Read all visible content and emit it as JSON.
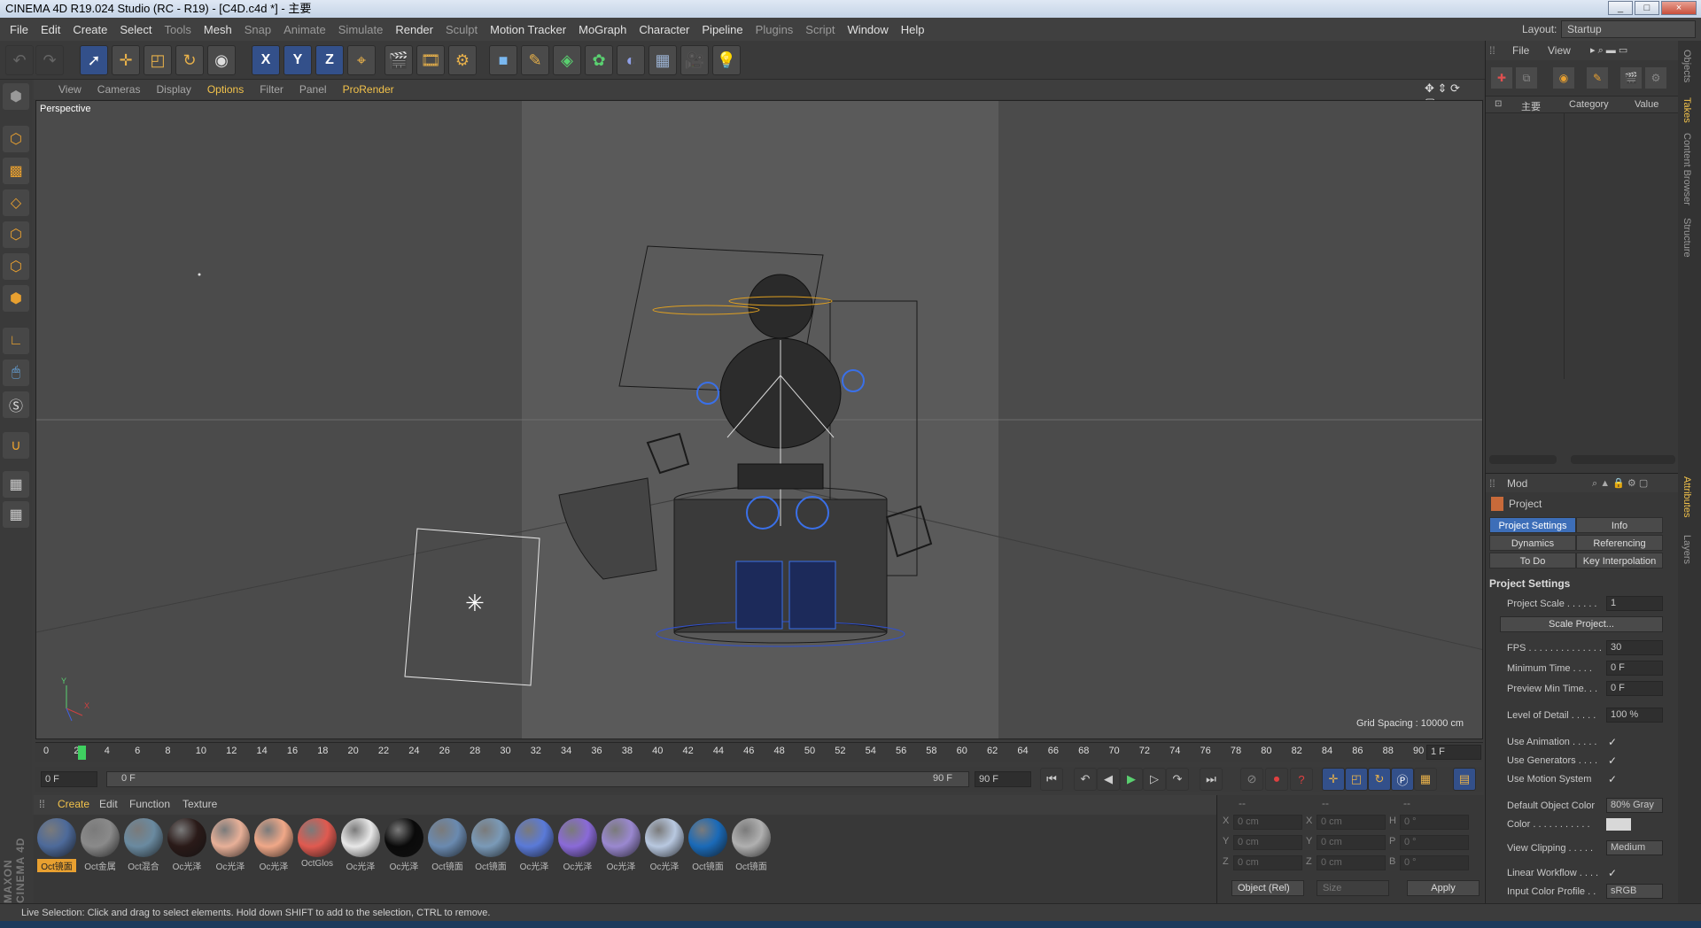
{
  "window": {
    "title": "CINEMA 4D R19.024 Studio (RC - R19) - [C4D.c4d *] - 主要",
    "controls": [
      "_",
      "□",
      "×"
    ]
  },
  "menu": [
    "File",
    "Edit",
    "Create",
    "Select",
    "Tools",
    "Mesh",
    "Snap",
    "Animate",
    "Simulate",
    "Render",
    "Sculpt",
    "Motion Tracker",
    "MoGraph",
    "Character",
    "Pipeline",
    "Plugins",
    "Script",
    "Window",
    "Help"
  ],
  "layout": {
    "label": "Layout:",
    "value": "Startup"
  },
  "toolbar": {
    "x": "X",
    "y": "Y",
    "z": "Z"
  },
  "viewport": {
    "menu": [
      "View",
      "Cameras",
      "Display",
      "Options",
      "Filter",
      "Panel",
      "ProRender"
    ],
    "name": "Perspective",
    "grid_spacing": "Grid Spacing : 10000 cm",
    "axis_y": "Y",
    "axis_x": "X"
  },
  "timeline": {
    "ticks": [
      "0",
      "2",
      "4",
      "6",
      "8",
      "10",
      "12",
      "14",
      "16",
      "18",
      "20",
      "22",
      "24",
      "26",
      "28",
      "30",
      "32",
      "34",
      "36",
      "38",
      "40",
      "42",
      "44",
      "46",
      "48",
      "50",
      "52",
      "54",
      "56",
      "58",
      "60",
      "62",
      "64",
      "66",
      "68",
      "70",
      "72",
      "74",
      "76",
      "78",
      "80",
      "82",
      "84",
      "86",
      "88",
      "90"
    ],
    "current": "1 F",
    "start": "0 F",
    "range_start": "0 F",
    "range_end": "90 F",
    "end": "90 F",
    "current_frame_fraction": 0.011
  },
  "materials": {
    "menu": [
      "Create",
      "Edit",
      "Function",
      "Texture"
    ],
    "items": [
      {
        "label": "Oct镜面",
        "color": "#4d6a9a"
      },
      {
        "label": "Oct金属",
        "color": "#8a8a8a"
      },
      {
        "label": "Oct混合",
        "color": "#6a8aa0"
      },
      {
        "label": "Oc光泽",
        "color": "#2a1a18"
      },
      {
        "label": "Oc光泽",
        "color": "#e8b098"
      },
      {
        "label": "Oc光泽",
        "color": "#f0a888"
      },
      {
        "label": "OctGlos",
        "color": "#e05a50"
      },
      {
        "label": "Oc光泽",
        "color": "#e8e8e8"
      },
      {
        "label": "Oc光泽",
        "color": "#0a0a0a"
      },
      {
        "label": "Oct镜面",
        "color": "#6a8ab0"
      },
      {
        "label": "Oct镜面",
        "color": "#7a9ab8"
      },
      {
        "label": "Oc光泽",
        "color": "#5a7ad8"
      },
      {
        "label": "Oc光泽",
        "color": "#8a6ad8"
      },
      {
        "label": "Oc光泽",
        "color": "#9a88d0"
      },
      {
        "label": "Oc光泽",
        "color": "#b8c8e0"
      },
      {
        "label": "Oct镜面",
        "color": "#1a6ab8"
      },
      {
        "label": "Oct镜面",
        "color": "#b0b0b0"
      }
    ]
  },
  "coords": {
    "header": [
      "--",
      "--",
      "--"
    ],
    "rows": [
      [
        "X",
        "0 cm",
        "X",
        "0 cm",
        "H",
        "0 °"
      ],
      [
        "Y",
        "0 cm",
        "Y",
        "0 cm",
        "P",
        "0 °"
      ],
      [
        "Z",
        "0 cm",
        "Z",
        "0 cm",
        "B",
        "0 °"
      ]
    ],
    "mode": "Object (Rel)",
    "size": "Size",
    "apply": "Apply"
  },
  "status": "Live Selection: Click and drag to select elements. Hold down SHIFT to add to the selection, CTRL to remove.",
  "objects": {
    "menu": [
      "File",
      "View"
    ],
    "take": "主要",
    "columns": [
      "Category",
      "Value"
    ]
  },
  "attributes": {
    "mode": "Mod",
    "title": "Project",
    "tabs": [
      "Project Settings",
      "Info",
      "Dynamics",
      "Referencing",
      "To Do",
      "Key Interpolation"
    ],
    "section": "Project Settings",
    "fields": {
      "scale": {
        "k": "Project Scale . . . . . .",
        "v": "1"
      },
      "scale_btn": "Scale Project...",
      "fps": {
        "k": "FPS . . . . . . . . . . . . . .",
        "v": "30"
      },
      "mintime": {
        "k": "Minimum Time . . . .",
        "v": "0 F"
      },
      "prevmin": {
        "k": "Preview Min Time. . .",
        "v": "0 F"
      },
      "lod": {
        "k": "Level of Detail . . . . .",
        "v": "100 %"
      },
      "useanim": "Use Animation . . . . .",
      "usegen": "Use Generators . . . .",
      "usemotion": "Use Motion System",
      "defcolor": {
        "k": "Default Object Color",
        "v": "80% Gray"
      },
      "color": "Color . . . . . . . . . . .",
      "clipping": {
        "k": "View Clipping . . . . .",
        "v": "Medium"
      },
      "linear": "Linear Workflow . . . .",
      "profile": {
        "k": "Input Color Profile . .",
        "v": "sRGB"
      }
    },
    "check": "✓"
  },
  "side_tabs": [
    "Objects",
    "Takes",
    "Content Browser",
    "Structure",
    "Attributes",
    "Layers"
  ],
  "maxon": "MAXON CINEMA 4D"
}
